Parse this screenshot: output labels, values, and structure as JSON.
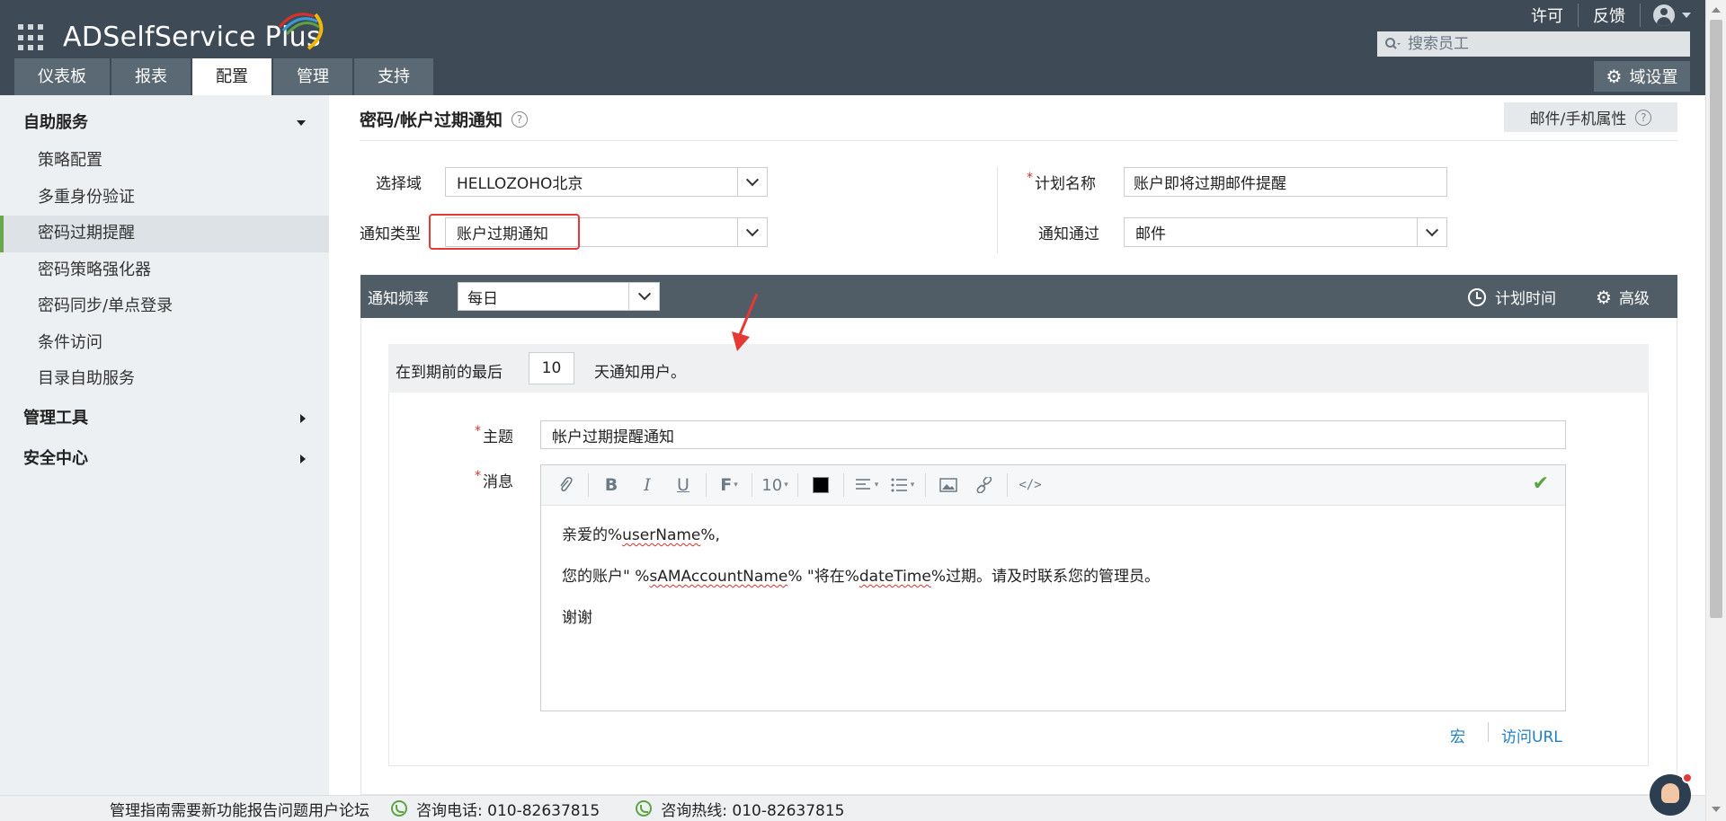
{
  "header": {
    "logo": "ADSelfService Plus",
    "top_links": [
      "许可",
      "反馈"
    ],
    "search_placeholder": "搜索员工",
    "tabs": [
      "仪表板",
      "报表",
      "配置",
      "管理",
      "支持"
    ],
    "active_tab": "配置",
    "domain_settings": "域设置"
  },
  "sidebar": {
    "sections": [
      {
        "label": "自助服务",
        "expanded": true
      },
      {
        "label": "管理工具",
        "expanded": false
      },
      {
        "label": "安全中心",
        "expanded": false
      }
    ],
    "items": [
      "策略配置",
      "多重身份验证",
      "密码过期提醒",
      "密码策略强化器",
      "密码同步/单点登录",
      "条件访问",
      "目录自助服务"
    ],
    "active_item": "密码过期提醒"
  },
  "main": {
    "title": "密码/帐户过期通知",
    "help": "?",
    "mail_props": "邮件/手机属性",
    "form": {
      "domain_label": "选择域",
      "domain_value": "HELLOZOHO北京",
      "notify_type_label": "通知类型",
      "notify_type_value": "账户过期通知",
      "plan_name_label": "计划名称",
      "plan_name_value": "账户即将过期邮件提醒",
      "notify_via_label": "通知通过",
      "notify_via_value": "邮件",
      "required_mark": "*"
    },
    "freq_bar": {
      "label": "通知频率",
      "value": "每日",
      "schedule": "计划时间",
      "advanced": "高级"
    },
    "notify": {
      "prefix": "在到期前的最后",
      "days": "10",
      "suffix": "天通知用户。"
    },
    "subject_label": "主题",
    "subject_value": "帐户过期提醒通知",
    "message_label": "消息",
    "toolbar": {
      "font_size": "10",
      "font_icon": "F"
    },
    "message": {
      "line1_pre": "亲爱的%",
      "line1_var": "userName",
      "line1_post": "%,",
      "line2_pre": "您的账户\" %",
      "line2_var": "sAMAccountName",
      "line2_mid": "% \"将在%",
      "line2_var2": "dateTime",
      "line2_post": "%过期。请及时联系您的管理员。",
      "line3": "谢谢"
    },
    "bottom_links": [
      "宏",
      "访问URL"
    ]
  },
  "footer": {
    "links": "管理指南需要新功能报告问题用户论坛",
    "phone1": "咨询电话: 010-82637815",
    "phone2": "咨询热线: 010-82637815"
  },
  "colors": {
    "header_bg": "#3e4b57",
    "tab_bg": "#5b6974",
    "freq_bar_bg": "#505c66",
    "highlight_red": "#e53935",
    "link_blue": "#1f7ec2",
    "check_green": "#5aa541"
  }
}
